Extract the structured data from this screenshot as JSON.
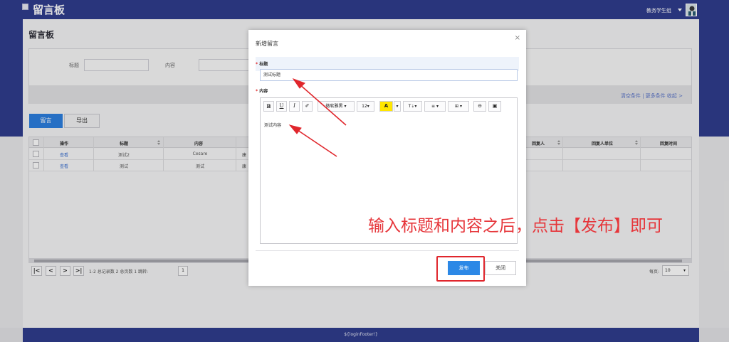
{
  "header": {
    "logo": "留言板",
    "user": "教务学生组"
  },
  "page": {
    "title": "留言板"
  },
  "search": {
    "title_label": "标题",
    "content_label": "内容",
    "links": "清空条件 | 更多条件  收起 >"
  },
  "actions": {
    "message_btn": "留言",
    "export_btn": "导出"
  },
  "table": {
    "headers": [
      "操作",
      "标题",
      "内容",
      "回复人",
      "回复人单位",
      "回复时间"
    ],
    "rows": [
      {
        "action": "查看",
        "title": "测试2",
        "content": "Cesare",
        "extra": "康"
      },
      {
        "action": "查看",
        "title": "测试",
        "content": "测试",
        "extra": "康"
      }
    ]
  },
  "pager": {
    "first": "|<",
    "prev": "<",
    "next": ">",
    "last": ">|",
    "info": "1-2 总记录数 2  总页数 1  跳转:",
    "page": "1",
    "size_label": "每页:",
    "size_value": "10"
  },
  "footer": "${loginFooter!}",
  "modal": {
    "title": "新增留言",
    "close": "×",
    "title_label": "标题",
    "title_value": "测试标题",
    "content_label": "内容",
    "required_mark": "*",
    "toolbar": {
      "bold": "B",
      "underline": "U",
      "italic": "I",
      "eraser": "✐",
      "font": "微软雅黑 ▾",
      "size": "12▾",
      "color": "A",
      "color_caret": "▾",
      "heading": "T⇣▾",
      "align": "≡ ▾",
      "table": "⊞ ▾",
      "link": "⊖",
      "image": "▣"
    },
    "content_value": "测试内容",
    "publish_btn": "发布",
    "close_btn": "关闭"
  },
  "annotation": {
    "text": "输入标题和内容之后，点击【发布】即可",
    "color": "#e6353a"
  }
}
